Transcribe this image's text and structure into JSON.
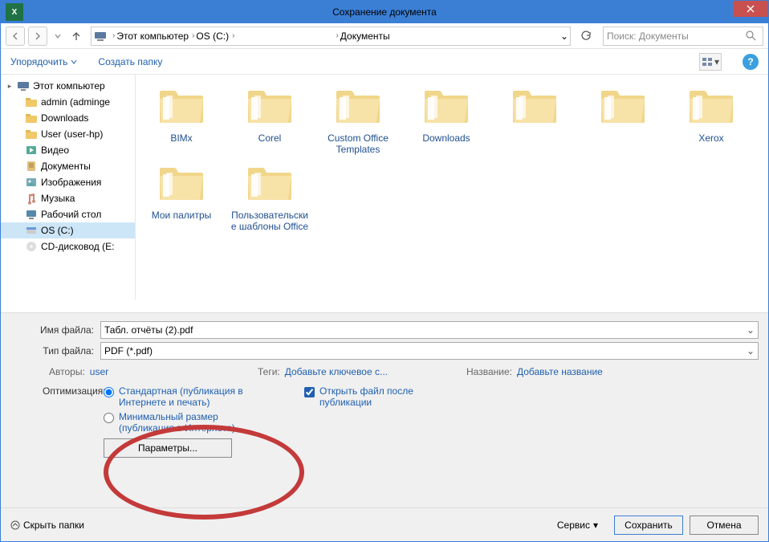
{
  "title": "Сохранение документа",
  "nav": {
    "crumbs": [
      "Этот компьютер",
      "OS (C:)",
      "",
      "Документы"
    ],
    "search_placeholder": "Поиск: Документы"
  },
  "toolbar": {
    "organize": "Упорядочить",
    "new_folder": "Создать папку"
  },
  "sidebar": {
    "root": "Этот компьютер",
    "items": [
      {
        "label": "admin (adminge",
        "icon": "folder"
      },
      {
        "label": "Downloads",
        "icon": "folder"
      },
      {
        "label": "User (user-hp)",
        "icon": "folder"
      },
      {
        "label": "Видео",
        "icon": "video"
      },
      {
        "label": "Документы",
        "icon": "docs"
      },
      {
        "label": "Изображения",
        "icon": "images"
      },
      {
        "label": "Музыка",
        "icon": "music"
      },
      {
        "label": "Рабочий стол",
        "icon": "desktop"
      },
      {
        "label": "OS (C:)",
        "icon": "disk",
        "selected": true
      },
      {
        "label": "CD-дисковод (E:",
        "icon": "cd"
      }
    ]
  },
  "folders": [
    {
      "label": "BIMx"
    },
    {
      "label": "Corel"
    },
    {
      "label": "Custom Office Templates"
    },
    {
      "label": "Downloads"
    },
    {
      "label": ""
    },
    {
      "label": ""
    },
    {
      "label": "Xerox"
    },
    {
      "label": "Мои палитры"
    },
    {
      "label": "Пользовательские шаблоны Office"
    }
  ],
  "filename_label": "Имя файла:",
  "filename_value": "Табл. отчёты (2).pdf",
  "filetype_label": "Тип файла:",
  "filetype_value": "PDF (*.pdf)",
  "meta": {
    "authors_label": "Авторы:",
    "authors_value": "user",
    "tags_label": "Теги:",
    "tags_value": "Добавьте ключевое с...",
    "title_label": "Название:",
    "title_value": "Добавьте название"
  },
  "optimize": {
    "label": "Оптимизация:",
    "opt1": "Стандартная (публикация в Интернете и печать)",
    "opt2": "Минимальный размер (публикация в Интернете)",
    "params_btn": "Параметры..."
  },
  "open_after": "Открыть файл после публикации",
  "footer": {
    "hide": "Скрыть папки",
    "service": "Сервис",
    "save": "Сохранить",
    "cancel": "Отмена"
  }
}
